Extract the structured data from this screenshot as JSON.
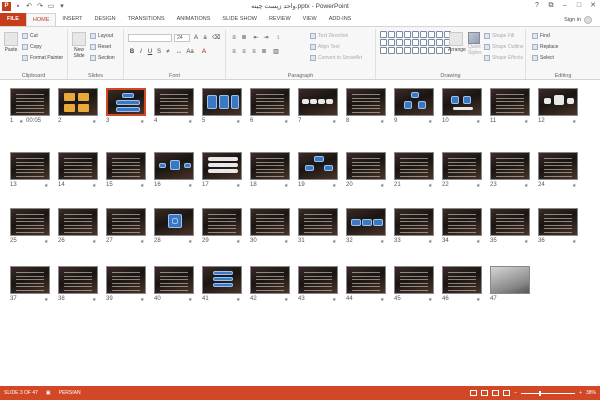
{
  "titlebar": {
    "title": "واحد زیست چینه.pptx - PowerPoint",
    "app_icon": "P",
    "qat_icons": [
      "save-icon",
      "undo-icon",
      "redo-icon",
      "present-icon",
      "customize-icon"
    ],
    "controls": [
      "?",
      "⧉",
      "–",
      "□",
      "✕"
    ]
  },
  "tabs": [
    "FILE",
    "HOME",
    "INSERT",
    "DESIGN",
    "TRANSITIONS",
    "ANIMATIONS",
    "SLIDE SHOW",
    "REVIEW",
    "VIEW",
    "ADD-INS"
  ],
  "active_tab": "HOME",
  "signin": "Sign in",
  "ribbon": {
    "clipboard": {
      "label": "Clipboard",
      "paste": "Paste",
      "cut": "Cut",
      "copy": "Copy",
      "format_painter": "Format Painter"
    },
    "slides": {
      "label": "Slides",
      "new_slide": "New Slide",
      "layout": "Layout",
      "reset": "Reset",
      "section": "Section"
    },
    "font": {
      "label": "Font",
      "font_name": "",
      "font_size": "24"
    },
    "paragraph": {
      "label": "Paragraph",
      "text_direction": "Text Direction",
      "align_text": "Align Text",
      "convert_smartart": "Convert to SmartArt"
    },
    "drawing": {
      "label": "Drawing",
      "arrange": "Arrange",
      "quick_styles": "Quick Styles",
      "shape_fill": "Shape Fill",
      "shape_outline": "Shape Outline",
      "shape_effects": "Shape Effects"
    },
    "editing": {
      "label": "Editing",
      "find": "Find",
      "replace": "Replace",
      "select": "Select"
    }
  },
  "slides": [
    {
      "n": "1",
      "star": "★",
      "time": "00:05"
    },
    {
      "n": "2",
      "star": "★"
    },
    {
      "n": "3",
      "star": "★"
    },
    {
      "n": "4",
      "star": "★"
    },
    {
      "n": "5",
      "star": "★"
    },
    {
      "n": "6",
      "star": "★"
    },
    {
      "n": "7",
      "star": "★"
    },
    {
      "n": "8",
      "star": "★"
    },
    {
      "n": "9",
      "star": "★"
    },
    {
      "n": "10",
      "star": "★"
    },
    {
      "n": "11",
      "star": "★"
    },
    {
      "n": "12",
      "star": "★"
    },
    {
      "n": "13",
      "star": "★"
    },
    {
      "n": "14",
      "star": "★"
    },
    {
      "n": "15",
      "star": "★"
    },
    {
      "n": "16",
      "star": "★"
    },
    {
      "n": "17",
      "star": "★"
    },
    {
      "n": "18",
      "star": "★"
    },
    {
      "n": "19",
      "star": "★"
    },
    {
      "n": "20",
      "star": "★"
    },
    {
      "n": "21",
      "star": "★"
    },
    {
      "n": "22",
      "star": "★"
    },
    {
      "n": "23",
      "star": "★"
    },
    {
      "n": "24",
      "star": "★"
    },
    {
      "n": "25",
      "star": "★"
    },
    {
      "n": "26",
      "star": "★"
    },
    {
      "n": "27",
      "star": "★"
    },
    {
      "n": "28",
      "star": "★"
    },
    {
      "n": "29",
      "star": "★"
    },
    {
      "n": "30",
      "star": "★"
    },
    {
      "n": "31",
      "star": "★"
    },
    {
      "n": "32",
      "star": "★"
    },
    {
      "n": "33",
      "star": "★"
    },
    {
      "n": "34",
      "star": "★"
    },
    {
      "n": "35",
      "star": "★"
    },
    {
      "n": "36",
      "star": "★"
    },
    {
      "n": "37",
      "star": "★"
    },
    {
      "n": "38",
      "star": "★"
    },
    {
      "n": "39",
      "star": "★"
    },
    {
      "n": "40",
      "star": "★"
    },
    {
      "n": "41",
      "star": "★"
    },
    {
      "n": "42",
      "star": "★"
    },
    {
      "n": "43",
      "star": "★"
    },
    {
      "n": "44",
      "star": "★"
    },
    {
      "n": "45",
      "star": "★"
    },
    {
      "n": "46",
      "star": "★"
    },
    {
      "n": "47",
      "star": ""
    }
  ],
  "selected_slide": "3",
  "status": {
    "slide": "SLIDE 3 OF 47",
    "language": "PERSIAN",
    "zoom": "38%"
  },
  "colors": {
    "accent": "#d24726",
    "file_tab": "#c43e1c"
  }
}
